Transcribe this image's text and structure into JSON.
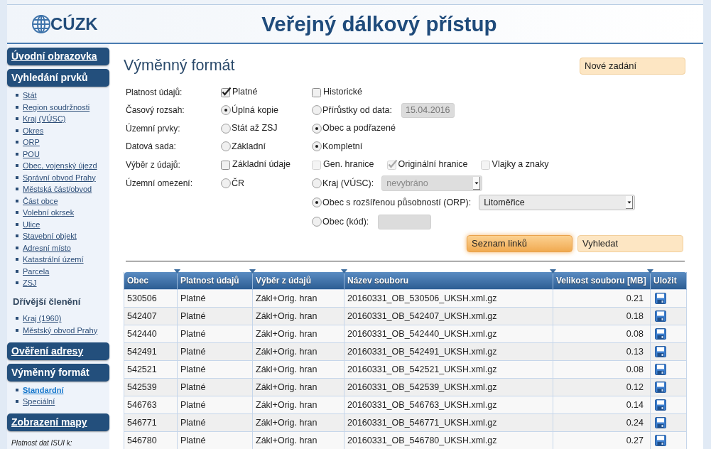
{
  "header": {
    "logo_text": "CÚZK",
    "title": "Veřejný dálkový přístup"
  },
  "sidebar": [
    {
      "kind": "link",
      "label": "Úvodní obrazovka"
    },
    {
      "kind": "group",
      "label": "Vyhledání prvků",
      "children": [
        {
          "kind": "link",
          "label": "Stát",
          "selected": false
        },
        {
          "kind": "link",
          "label": "Region soudržnosti",
          "selected": false
        },
        {
          "kind": "link",
          "label": "Kraj (VÚSC)",
          "selected": false
        },
        {
          "kind": "link",
          "label": "Okres",
          "selected": false
        },
        {
          "kind": "link",
          "label": "ORP",
          "selected": false
        },
        {
          "kind": "link",
          "label": "POU",
          "selected": false
        },
        {
          "kind": "link",
          "label": "Obec, vojenský újezd",
          "selected": false
        },
        {
          "kind": "link",
          "label": "Správní obvod Prahy",
          "selected": false
        },
        {
          "kind": "link",
          "label": "Městská část/obvod",
          "selected": false
        },
        {
          "kind": "link",
          "label": "Část obce",
          "selected": false
        },
        {
          "kind": "link",
          "label": "Volební okrsek",
          "selected": false
        },
        {
          "kind": "link",
          "label": "Ulice",
          "selected": false
        },
        {
          "kind": "link",
          "label": "Stavební objekt",
          "selected": false
        },
        {
          "kind": "link",
          "label": "Adresní místo",
          "selected": false
        },
        {
          "kind": "link",
          "label": "Katastrální území",
          "selected": false
        },
        {
          "kind": "link",
          "label": "Parcela",
          "selected": false
        },
        {
          "kind": "link",
          "label": "ZSJ",
          "selected": false
        },
        {
          "kind": "heading",
          "label": "Dřívější členění"
        },
        {
          "kind": "link",
          "label": "Kraj (1960)",
          "selected": false
        },
        {
          "kind": "link",
          "label": "Městský obvod Prahy",
          "selected": false
        }
      ]
    },
    {
      "kind": "link",
      "label": "Ověření adresy"
    },
    {
      "kind": "group",
      "label": "Výměnný formát",
      "children": [
        {
          "kind": "link",
          "label": "Standardní",
          "selected": true
        },
        {
          "kind": "link",
          "label": "Speciální",
          "selected": false
        }
      ]
    },
    {
      "kind": "link",
      "label": "Zobrazení mapy"
    },
    {
      "kind": "note",
      "label": "Platnost dat ISUI k:"
    }
  ],
  "main": {
    "title": "Výměnný formát",
    "new_button": "Nové zadání",
    "form": [
      {
        "label": "Platnost údajů:",
        "left": {
          "kind": "checkbox",
          "label": "Platné",
          "checked": true,
          "disabled": false
        },
        "right": [
          [
            {
              "kind": "checkbox",
              "label": "Historické",
              "checked": false,
              "disabled": false
            }
          ]
        ]
      },
      {
        "label": "Časový rozsah:",
        "left": {
          "kind": "radio",
          "label": "Úplná kopie",
          "selected": true
        },
        "right": [
          [
            {
              "kind": "radio",
              "label": "Přírůstky od data:",
              "selected": false,
              "field": {
                "kind": "text",
                "value": "15.04.2016",
                "disabled": true
              }
            }
          ]
        ]
      },
      {
        "label": "Územní prvky:",
        "left": {
          "kind": "radio",
          "label": "Stát až ZSJ",
          "selected": false
        },
        "right": [
          [
            {
              "kind": "radio",
              "label": "Obec a podřazené",
              "selected": true
            }
          ]
        ]
      },
      {
        "label": "Datová sada:",
        "left": {
          "kind": "radio",
          "label": "Základní",
          "selected": false
        },
        "right": [
          [
            {
              "kind": "radio",
              "label": "Kompletní",
              "selected": true
            }
          ]
        ]
      },
      {
        "label": "Výběr z údajů:",
        "left": {
          "kind": "checkbox",
          "label": "Základní údaje",
          "checked": false,
          "disabled": false
        },
        "right": [
          [
            {
              "kind": "checkbox",
              "label": "Gen. hranice",
              "checked": false,
              "disabled": true
            },
            {
              "kind": "checkbox",
              "label": "Originální hranice",
              "checked": true,
              "disabled": true
            },
            {
              "kind": "checkbox",
              "label": "Vlajky a znaky",
              "checked": false,
              "disabled": true
            }
          ]
        ]
      },
      {
        "label": "Územní omezení:",
        "left": {
          "kind": "radio",
          "label": "ČR",
          "selected": false
        },
        "right": [
          [
            {
              "kind": "radio",
              "label": "Kraj (VÚSC):",
              "selected": false,
              "field": {
                "kind": "select",
                "value": "nevybráno",
                "disabled": true
              }
            }
          ],
          [
            {
              "kind": "radio",
              "label": "Obec s rozšířenou působností (ORP):",
              "selected": true,
              "field": {
                "kind": "select",
                "value": "Litoměřice",
                "disabled": false
              }
            }
          ],
          [
            {
              "kind": "radio",
              "label": "Obec (kód):",
              "selected": false,
              "field": {
                "kind": "text",
                "disabled": true
              }
            }
          ]
        ]
      }
    ],
    "actions": [
      {
        "label": "Seznam linků",
        "selected": true
      },
      {
        "label": "Vyhledat",
        "selected": false
      }
    ],
    "table": {
      "columns": [
        {
          "label": "Obec",
          "kind": "text"
        },
        {
          "label": "Platnost údajů",
          "kind": "text"
        },
        {
          "label": "Výběr z údajů",
          "kind": "text"
        },
        {
          "label": "Název souboru",
          "kind": "text"
        },
        {
          "label": "Velikost souboru [MB]",
          "kind": "number"
        },
        {
          "label": "Uložit",
          "kind": "action"
        }
      ],
      "rows": [
        {
          "cells": [
            "530506",
            "Platné",
            "Zákl+Orig. hran",
            "20160331_OB_530506_UKSH.xml.gz",
            "0.21"
          ]
        },
        {
          "cells": [
            "542407",
            "Platné",
            "Zákl+Orig. hran",
            "20160331_OB_542407_UKSH.xml.gz",
            "0.18"
          ]
        },
        {
          "cells": [
            "542440",
            "Platné",
            "Zákl+Orig. hran",
            "20160331_OB_542440_UKSH.xml.gz",
            "0.08"
          ]
        },
        {
          "cells": [
            "542491",
            "Platné",
            "Zákl+Orig. hran",
            "20160331_OB_542491_UKSH.xml.gz",
            "0.13"
          ]
        },
        {
          "cells": [
            "542521",
            "Platné",
            "Zákl+Orig. hran",
            "20160331_OB_542521_UKSH.xml.gz",
            "0.08"
          ]
        },
        {
          "cells": [
            "542539",
            "Platné",
            "Zákl+Orig. hran",
            "20160331_OB_542539_UKSH.xml.gz",
            "0.12"
          ]
        },
        {
          "cells": [
            "546763",
            "Platné",
            "Zákl+Orig. hran",
            "20160331_OB_546763_UKSH.xml.gz",
            "0.14"
          ]
        },
        {
          "cells": [
            "546771",
            "Platné",
            "Zákl+Orig. hran",
            "20160331_OB_546771_UKSH.xml.gz",
            "0.24"
          ]
        },
        {
          "cells": [
            "546780",
            "Platné",
            "Zákl+Orig. hran",
            "20160331_OB_546780_UKSH.xml.gz",
            "0.27"
          ]
        }
      ]
    }
  }
}
